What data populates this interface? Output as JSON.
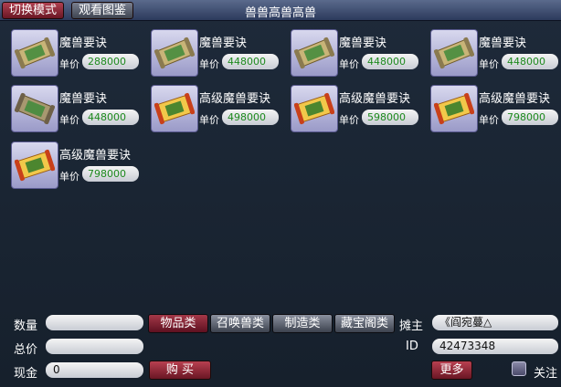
{
  "header": {
    "mode_button": "切换模式",
    "catalog_button": "观看图鉴",
    "title": "兽兽高兽高兽"
  },
  "price_label": "单价",
  "items": [
    {
      "name": "魔兽要诀",
      "price": "288000",
      "kind": "normal"
    },
    {
      "name": "魔兽要诀",
      "price": "448000",
      "kind": "normal"
    },
    {
      "name": "魔兽要诀",
      "price": "448000",
      "kind": "normal"
    },
    {
      "name": "魔兽要诀",
      "price": "448000",
      "kind": "normal"
    },
    {
      "name": "魔兽要诀",
      "price": "448000",
      "kind": "normal"
    },
    {
      "name": "高级魔兽要诀",
      "price": "498000",
      "kind": "advanced"
    },
    {
      "name": "高级魔兽要诀",
      "price": "598000",
      "kind": "advanced"
    },
    {
      "name": "高级魔兽要诀",
      "price": "798000",
      "kind": "advanced"
    },
    {
      "name": "高级魔兽要诀",
      "price": "798000",
      "kind": "advanced"
    }
  ],
  "footer": {
    "quantity_label": "数量",
    "quantity_value": "",
    "total_label": "总价",
    "total_value": "",
    "cash_label": "现金",
    "cash_value": "0",
    "buy_button": "购 买",
    "categories": [
      "物品类",
      "召唤兽类",
      "制造类",
      "藏宝阁类"
    ],
    "owner_label": "摊主",
    "owner_value": "《阎宛蔓△",
    "id_label": "ID",
    "id_value": "42473348",
    "more_button": "更多",
    "follow_label": "关注"
  },
  "colors": {
    "price_text": "#1d8a1d",
    "active_button": "#a43848",
    "panel_bg": "#1e2a3a"
  }
}
